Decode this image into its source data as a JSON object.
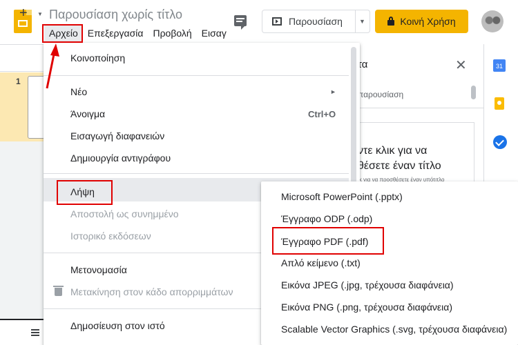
{
  "header": {
    "doc_title": "Παρουσίαση χωρίς τίτλο",
    "menus": [
      "Αρχείο",
      "Επεξεργασία",
      "Προβολή",
      "Εισαγ"
    ],
    "present_label": "Παρουσίαση",
    "share_label": "Κοινή Χρήση",
    "share_color": "#f4b400"
  },
  "toolbar": {
    "add_label": "+"
  },
  "filmstrip": {
    "slide_number": "1"
  },
  "theme_panel": {
    "title": "τα",
    "close": "✕",
    "subtitle": "παρουσίαση",
    "preview_line1": "ντε κλικ για να",
    "preview_line2": "θέσετε έναν τίτλο",
    "preview_line3": "ίκ για να προσθέσετε έναν υπότιτλο"
  },
  "side_apps": {
    "calendar_day": "31"
  },
  "file_menu": {
    "share": "Κοινοποίηση",
    "new": "Νέο",
    "new_arrow": "►",
    "open": "Άνοιγμα",
    "open_shortcut": "Ctrl+O",
    "import": "Εισαγωγή διαφανειών",
    "copy": "Δημιουργία αντιγράφου",
    "download": "Λήψη",
    "email": "Αποστολή ως συνημμένο",
    "history": "Ιστορικό εκδόσεων",
    "rename": "Μετονομασία",
    "trash": "Μετακίνηση στον κάδο απορριμμάτων",
    "publish": "Δημοσίευση στον ιστό"
  },
  "download_menu": {
    "items": [
      "Microsoft PowerPoint (.pptx)",
      "Έγγραφο ODP (.odp)",
      "Έγγραφο PDF (.pdf)",
      "Απλό κείμενο (.txt)",
      "Εικόνα JPEG (.jpg, τρέχουσα διαφάνεια)",
      "Εικόνα PNG (.png, τρέχουσα διαφάνεια)",
      "Scalable Vector Graphics (.svg, τρέχουσα διαφάνεια)"
    ]
  },
  "annotation_color": "#e00000"
}
